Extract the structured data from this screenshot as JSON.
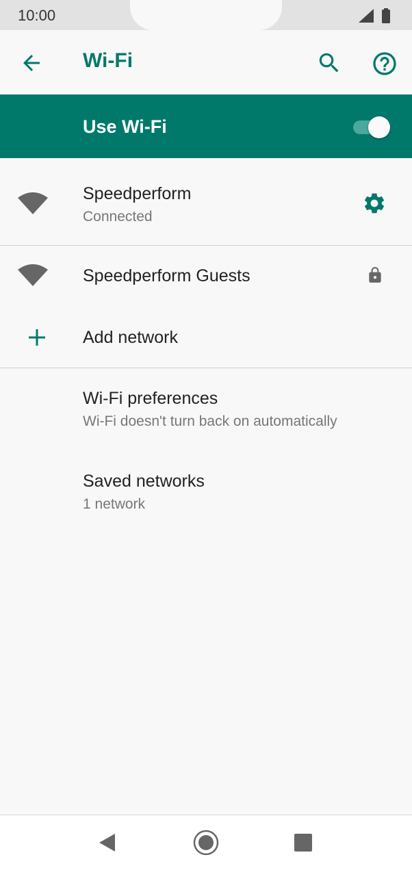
{
  "status_bar": {
    "time": "10:00"
  },
  "app_bar": {
    "title": "Wi-Fi"
  },
  "use_wifi": {
    "label": "Use Wi-Fi",
    "toggle_state": "on"
  },
  "networks": [
    {
      "name": "Speedperform",
      "status": "Connected",
      "icon": "wifi-icon",
      "action_icon": "gear-icon"
    },
    {
      "name": "Speedperform Guests",
      "icon": "wifi-icon",
      "action_icon": "lock-icon"
    }
  ],
  "add_network": {
    "label": "Add network",
    "icon": "plus-icon"
  },
  "preferences": {
    "title": "Wi-Fi preferences",
    "subtitle": "Wi-Fi doesn't turn back on automatically"
  },
  "saved_networks": {
    "title": "Saved networks",
    "subtitle": "1 network"
  },
  "colors": {
    "accent": "#00796b",
    "toggle_track": "#4aa99c",
    "background": "#f8f8f8"
  }
}
